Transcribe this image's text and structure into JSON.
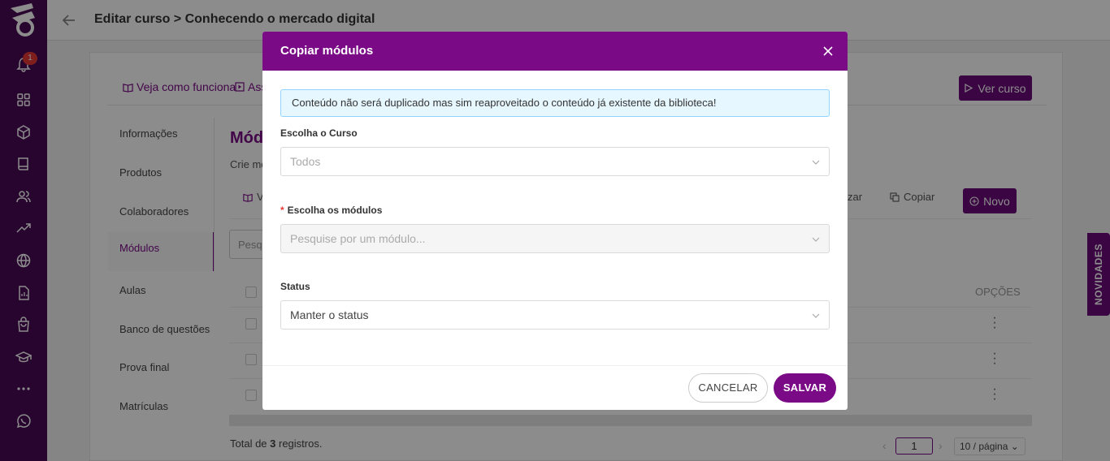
{
  "header": {
    "title": "Editar curso > Conhecendo o mercado digital"
  },
  "rail": {
    "notification_count": "1"
  },
  "card": {
    "link_how_it_works": "Veja como funciona",
    "link_assist": "Ass",
    "view_course": "Ver curso"
  },
  "nav": {
    "items": [
      "Informações",
      "Produtos",
      "Colaboradores",
      "Módulos",
      "Aulas",
      "Banco de questões",
      "Prova final",
      "Matrículas"
    ]
  },
  "main": {
    "title": "Mód",
    "subtitle": "Crie mó",
    "tool_partial": "V",
    "tool_reorder": "zar",
    "tool_copy": "Copiar",
    "new_button": "Novo",
    "search_placeholder": "Pesqu",
    "options_header": "OPÇÕES",
    "total_prefix": "Total de ",
    "total_count": "3",
    "total_suffix": " registros.",
    "current_page": "1",
    "page_size": "10 / página"
  },
  "novidades": "NOVIDADES",
  "modal": {
    "title": "Copiar módulos",
    "info": "Conteúdo não será duplicado mas sim reaproveitado o conteúdo já existente da biblioteca!",
    "course_label": "Escolha o Curso",
    "course_value": "Todos",
    "modules_label": "Escolha os módulos",
    "modules_placeholder": "Pesquise por um módulo...",
    "status_label": "Status",
    "status_value": "Manter o status",
    "cancel": "CANCELAR",
    "save": "SALVAR"
  },
  "colors": {
    "accent": "#7a0a86",
    "rail": "#4a0a57",
    "info_bg": "#e6f7ff"
  },
  "icons": [
    "bell-icon",
    "grid-icon",
    "cube-icon",
    "book-icon",
    "users-icon",
    "trend-icon",
    "globe-icon",
    "report-icon",
    "bag-icon",
    "graduation-icon",
    "more-icon",
    "whatsapp-icon"
  ]
}
